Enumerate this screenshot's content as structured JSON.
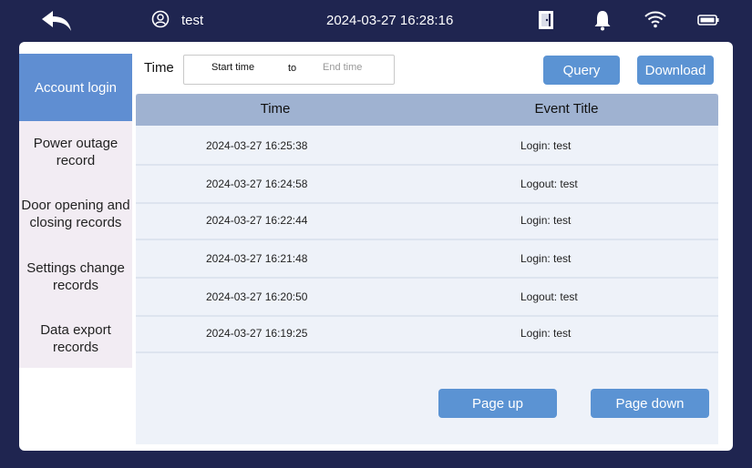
{
  "header": {
    "username": "test",
    "datetime": "2024-03-27 16:28:16",
    "icons": [
      "back-icon",
      "user-icon",
      "door-icon",
      "bell-icon",
      "wifi-icon",
      "battery-icon"
    ]
  },
  "sidebar": {
    "items": [
      {
        "lines": [
          "Account login"
        ],
        "active": true
      },
      {
        "lines": [
          "Power outage",
          "record"
        ],
        "active": false
      },
      {
        "lines": [
          "Door opening and",
          "closing records"
        ],
        "active": false
      },
      {
        "lines": [
          "Settings change",
          "records"
        ],
        "active": false
      },
      {
        "lines": [
          "Data export",
          "records"
        ],
        "active": false
      }
    ]
  },
  "filter": {
    "label": "Time",
    "start_placeholder": "Start time",
    "to_label": "to",
    "end_placeholder": "End time",
    "query_label": "Query",
    "download_label": "Download"
  },
  "table": {
    "columns": [
      "Time",
      "Event Title"
    ],
    "rows": [
      {
        "time": "2024-03-27 16:25:38",
        "event": "Login: test"
      },
      {
        "time": "2024-03-27 16:24:58",
        "event": "Logout: test"
      },
      {
        "time": "2024-03-27 16:22:44",
        "event": "Login: test"
      },
      {
        "time": "2024-03-27 16:21:48",
        "event": "Login: test"
      },
      {
        "time": "2024-03-27 16:20:50",
        "event": "Logout: test"
      },
      {
        "time": "2024-03-27 16:19:25",
        "event": "Login: test"
      }
    ]
  },
  "pagination": {
    "prev_label": "Page up",
    "next_label": "Page down"
  },
  "colors": {
    "background": "#1f2550",
    "accent": "#5b93d3",
    "active_tab": "#5f8ed2",
    "table_header": "#9fb2d1",
    "table_body": "#eef2f9",
    "sidebar_item": "#f2ecf3"
  }
}
